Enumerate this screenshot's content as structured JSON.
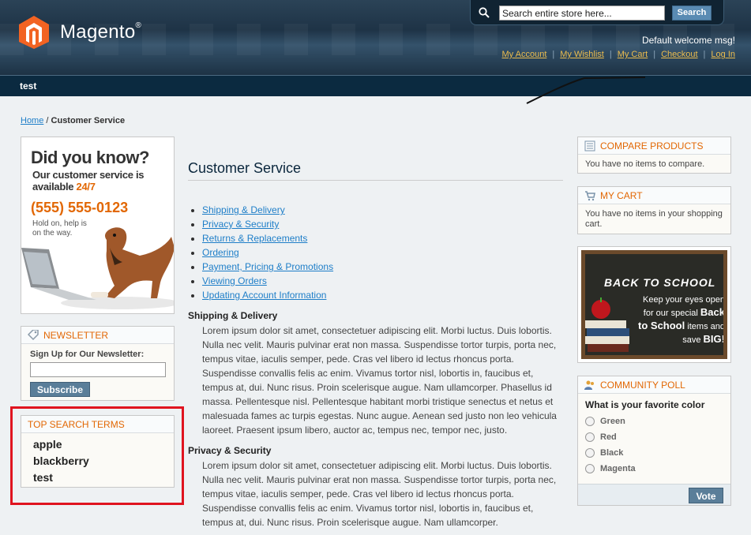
{
  "header": {
    "logo_text": "Magento",
    "logo_reg": "®",
    "search_placeholder": "Search entire store here...",
    "search_button": "Search",
    "welcome": "Default welcome msg!",
    "links": [
      "My Account",
      "My Wishlist",
      "My Cart",
      "Checkout",
      "Log In"
    ]
  },
  "nav": {
    "item": "test"
  },
  "breadcrumb": {
    "home": "Home",
    "separator": "/",
    "current": "Customer Service"
  },
  "left": {
    "promo": {
      "title": "Did you know?",
      "line1": "Our customer service is available",
      "hours": "24/7",
      "phone": "(555) 555-0123",
      "line2": "Hold on, help is on the way."
    },
    "newsletter": {
      "title": "Newsletter",
      "label": "Sign Up for Our Newsletter:",
      "button": "Subscribe"
    },
    "top_search": {
      "title": "Top Search Terms",
      "terms": [
        "apple",
        "blackberry",
        "test"
      ]
    }
  },
  "main": {
    "title": "Customer Service",
    "toc": [
      "Shipping & Delivery",
      "Privacy & Security",
      "Returns & Replacements",
      "Ordering",
      "Payment, Pricing & Promotions",
      "Viewing Orders",
      "Updating Account Information"
    ],
    "sections": [
      {
        "heading": "Shipping & Delivery",
        "body": "Lorem ipsum dolor sit amet, consectetuer adipiscing elit. Morbi luctus. Duis lobortis. Nulla nec velit. Mauris pulvinar erat non massa. Suspendisse tortor turpis, porta nec, tempus vitae, iaculis semper, pede. Cras vel libero id lectus rhoncus porta. Suspendisse convallis felis ac enim. Vivamus tortor nisl, lobortis in, faucibus et, tempus at, dui. Nunc risus. Proin scelerisque augue. Nam ullamcorper. Phasellus id massa. Pellentesque nisl. Pellentesque habitant morbi tristique senectus et netus et malesuada fames ac turpis egestas. Nunc augue. Aenean sed justo non leo vehicula laoreet. Praesent ipsum libero, auctor ac, tempus nec, tempor nec, justo."
      },
      {
        "heading": "Privacy & Security",
        "body": "Lorem ipsum dolor sit amet, consectetuer adipiscing elit. Morbi luctus. Duis lobortis. Nulla nec velit. Mauris pulvinar erat non massa. Suspendisse tortor turpis, porta nec, tempus vitae, iaculis semper, pede. Cras vel libero id lectus rhoncus porta. Suspendisse convallis felis ac enim. Vivamus tortor nisl, lobortis in, faucibus et, tempus at, dui. Nunc risus. Proin scelerisque augue. Nam ullamcorper."
      }
    ]
  },
  "right": {
    "compare": {
      "title": "Compare Products",
      "body": "You have no items to compare."
    },
    "cart": {
      "title": "My Cart",
      "body": "You have no items in your shopping cart."
    },
    "promo": {
      "title": "BACK TO SCHOOL",
      "line1": "Keep your eyes open for our special",
      "big1": "Back to School",
      "line2": "items and save",
      "big2": "BIG!"
    },
    "poll": {
      "title": "Community Poll",
      "question": "What is your favorite color",
      "options": [
        "Green",
        "Red",
        "Black",
        "Magenta"
      ],
      "button": "Vote"
    }
  },
  "colors": {
    "accent": "#e26703",
    "link": "#1e7ec8",
    "header": "#1e3346",
    "highlight": "#e0141f"
  }
}
